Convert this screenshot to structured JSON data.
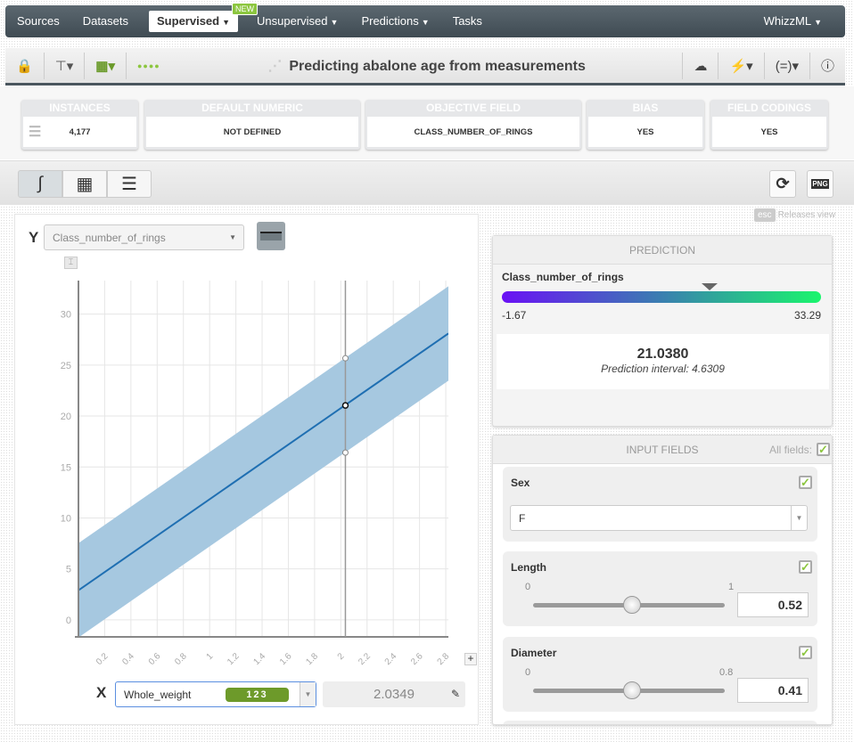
{
  "nav": {
    "items": [
      "Sources",
      "Datasets",
      "Supervised",
      "Unsupervised",
      "Predictions",
      "Tasks"
    ],
    "active": "Supervised",
    "new_badge": "NEW",
    "right": "WhizzML"
  },
  "toolbar": {
    "title": "Predicting abalone age from measurements",
    "status_dots": "●●●●",
    "icons": [
      "lock-icon",
      "model-tree-icon",
      "field-types-icon",
      "cloud-download-icon",
      "batch-predict-icon",
      "formula-icon",
      "info-icon"
    ]
  },
  "summary": [
    {
      "label": "INSTANCES",
      "value": "4,177"
    },
    {
      "label": "DEFAULT NUMERIC",
      "value": "NOT DEFINED"
    },
    {
      "label": "OBJECTIVE FIELD",
      "value": "CLASS_NUMBER_OF_RINGS"
    },
    {
      "label": "BIAS",
      "value": "YES"
    },
    {
      "label": "FIELD CODINGS",
      "value": "YES"
    }
  ],
  "view": {
    "esc": "esc",
    "releases": "Releases view",
    "png": "PNG"
  },
  "chart": {
    "y_label": "Y",
    "y_field": "Class_number_of_rings",
    "x_label": "X",
    "x_field": "Whole_weight",
    "x_type_badge": "123",
    "x_value": "2.0349"
  },
  "chart_data": {
    "type": "line",
    "xlabel": "Whole_weight",
    "ylabel": "Class_number_of_rings",
    "xlim": [
      0,
      2.82
    ],
    "ylim": [
      -1.67,
      33.29
    ],
    "grid": true,
    "x_ticks": [
      "0.2",
      "0.4",
      "0.6",
      "0.8",
      "1",
      "1.2",
      "1.4",
      "1.6",
      "1.8",
      "2",
      "2.2",
      "2.4",
      "2.6",
      "2.8"
    ],
    "y_ticks": [
      "0",
      "5",
      "10",
      "15",
      "20",
      "25",
      "30"
    ],
    "line": {
      "x": [
        0,
        2.82
      ],
      "y": [
        2.9,
        28.1
      ]
    },
    "band_halfwidth": 4.63,
    "marker": {
      "x": 2.0349,
      "y": 21.038,
      "upper": 25.67,
      "lower": 16.41
    },
    "colors": {
      "line": "#1f6fb2",
      "band": "#a6c8e0"
    }
  },
  "prediction": {
    "header": "PREDICTION",
    "field": "Class_number_of_rings",
    "min": "-1.67",
    "max": "33.29",
    "value": "21.0380",
    "interval": "Prediction interval: 4.6309",
    "fraction": 0.65
  },
  "inputs": {
    "header": "INPUT FIELDS",
    "all_fields": "All fields:",
    "sex": {
      "name": "Sex",
      "value": "F"
    },
    "length": {
      "name": "Length",
      "min": "0",
      "max": "1",
      "value": "0.52",
      "fraction": 0.52
    },
    "diameter": {
      "name": "Diameter",
      "min": "0",
      "max": "0.8",
      "value": "0.41",
      "fraction": 0.51
    }
  }
}
